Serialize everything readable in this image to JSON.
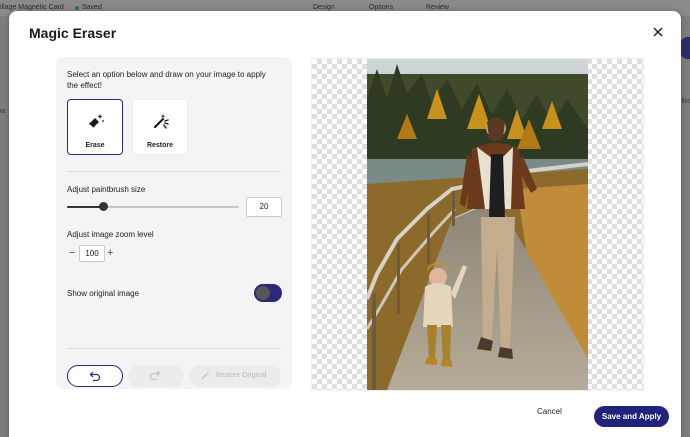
{
  "background": {
    "doc_title": "illage Magnetic Card",
    "status": "Saved",
    "tabs": [
      "Design",
      "Options",
      "Review"
    ],
    "right_partial": "ellin",
    "left_partial": "w."
  },
  "modal": {
    "title": "Magic Eraser",
    "instructions": "Select an option below and draw on your image to apply the effect!",
    "tools": [
      {
        "label": "Erase",
        "icon": "eraser-sparkle-icon",
        "selected": true
      },
      {
        "label": "Restore",
        "icon": "magic-wand-icon",
        "selected": false
      }
    ],
    "brush": {
      "label": "Adjust paintbrush size",
      "value": "20",
      "fraction": 0.21
    },
    "zoom": {
      "label": "Adjust image zoom level",
      "value": "100"
    },
    "show_original": {
      "label": "Show original image",
      "enabled": true
    },
    "actions": {
      "restore_label": "Restore Original"
    },
    "footer": {
      "cancel_label": "Cancel",
      "apply_label": "Save and Apply"
    },
    "colors": {
      "accent": "#23227a",
      "panel": "#f4f4f4"
    }
  }
}
